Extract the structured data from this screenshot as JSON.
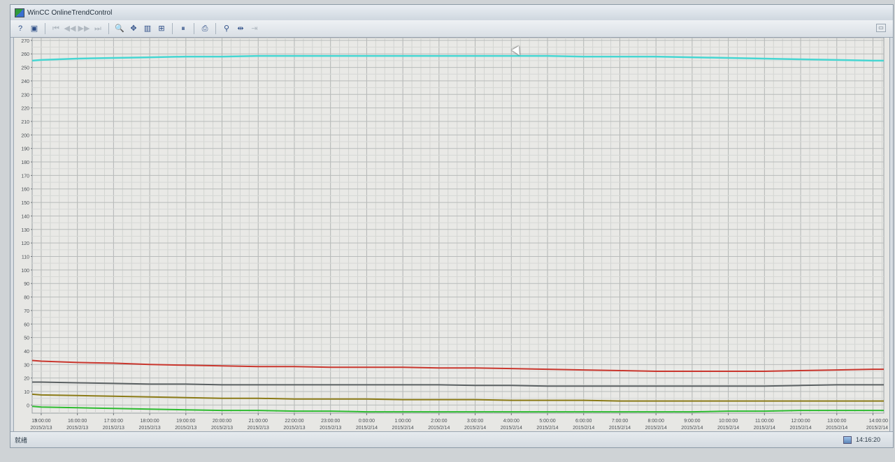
{
  "window": {
    "title": "WinCC OnlineTrendControl"
  },
  "toolbar": {
    "buttons": [
      {
        "name": "help-icon",
        "glyph": "?",
        "enabled": true
      },
      {
        "name": "config-dialog-icon",
        "glyph": "▣",
        "enabled": true
      },
      {
        "name": "first-record-icon",
        "glyph": "⏮",
        "enabled": false
      },
      {
        "name": "previous-record-icon",
        "glyph": "◀◀",
        "enabled": false
      },
      {
        "name": "next-record-icon",
        "glyph": "▶▶",
        "enabled": false
      },
      {
        "name": "last-record-icon",
        "glyph": "⏭",
        "enabled": false
      },
      {
        "name": "zoom-area-icon",
        "glyph": "🔍",
        "enabled": true
      },
      {
        "name": "move-axes-icon",
        "glyph": "✥",
        "enabled": true
      },
      {
        "name": "select-trend-icon",
        "glyph": "▥",
        "enabled": true
      },
      {
        "name": "original-view-icon",
        "glyph": "⊞",
        "enabled": true
      },
      {
        "name": "stop-icon",
        "glyph": "⏸",
        "enabled": true
      },
      {
        "name": "print-icon",
        "glyph": "⎙",
        "enabled": true
      },
      {
        "name": "ruler-icon",
        "glyph": "⚲",
        "enabled": true
      },
      {
        "name": "select-time-range-icon",
        "glyph": "⇹",
        "enabled": true
      },
      {
        "name": "export-icon",
        "glyph": "⇥",
        "enabled": false
      }
    ]
  },
  "chart_data": {
    "type": "line",
    "yticks": [
      0,
      10,
      20,
      30,
      40,
      50,
      60,
      70,
      80,
      90,
      100,
      110,
      120,
      130,
      140,
      150,
      160,
      170,
      180,
      190,
      200,
      210,
      220,
      230,
      240,
      250,
      260,
      270
    ],
    "ytick_labels": [
      "0",
      "10",
      "20",
      "30",
      "40",
      "50",
      "60",
      "70",
      "80",
      "90",
      "100",
      "110",
      "120",
      "130",
      "140",
      "150",
      "160",
      "170",
      "180",
      "190",
      "200",
      "210",
      "220",
      "230",
      "240",
      "250",
      "260",
      "270"
    ],
    "ylim": [
      -6,
      272
    ],
    "x_ticks": [
      {
        "time": "15:00:00",
        "date": "2015/2/13"
      },
      {
        "time": "16:00:00",
        "date": "2015/2/13"
      },
      {
        "time": "17:00:00",
        "date": "2015/2/13"
      },
      {
        "time": "18:00:00",
        "date": "2015/2/13"
      },
      {
        "time": "19:00:00",
        "date": "2015/2/13"
      },
      {
        "time": "20:00:00",
        "date": "2015/2/13"
      },
      {
        "time": "21:00:00",
        "date": "2015/2/13"
      },
      {
        "time": "22:00:00",
        "date": "2015/2/13"
      },
      {
        "time": "23:00:00",
        "date": "2015/2/13"
      },
      {
        "time": "0:00:00",
        "date": "2015/2/14"
      },
      {
        "time": "1:00:00",
        "date": "2015/2/14"
      },
      {
        "time": "2:00:00",
        "date": "2015/2/14"
      },
      {
        "time": "3:00:00",
        "date": "2015/2/14"
      },
      {
        "time": "4:00:00",
        "date": "2015/2/14"
      },
      {
        "time": "5:00:00",
        "date": "2015/2/14"
      },
      {
        "time": "6:00:00",
        "date": "2015/2/14"
      },
      {
        "time": "7:00:00",
        "date": "2015/2/14"
      },
      {
        "time": "8:00:00",
        "date": "2015/2/14"
      },
      {
        "time": "9:00:00",
        "date": "2015/2/14"
      },
      {
        "time": "10:00:00",
        "date": "2015/2/14"
      },
      {
        "time": "11:00:00",
        "date": "2015/2/14"
      },
      {
        "time": "12:00:00",
        "date": "2015/2/14"
      },
      {
        "time": "13:00:00",
        "date": "2015/2/14"
      },
      {
        "time": "14:00:00",
        "date": "2015/2/14"
      }
    ],
    "x_start_label": "3",
    "x_hours": [
      14.75,
      15,
      16,
      17,
      18,
      19,
      20,
      21,
      22,
      23,
      24,
      25,
      26,
      27,
      28,
      29,
      30,
      31,
      32,
      33,
      34,
      35,
      36,
      37,
      38,
      38.3
    ],
    "series": [
      {
        "color": "#46d6d2",
        "values": [
          255,
          255.5,
          256.5,
          257,
          257.5,
          258,
          258,
          258.5,
          258.5,
          258.5,
          258.5,
          258.5,
          258.5,
          258.5,
          258.5,
          258.5,
          258,
          258,
          258,
          257.5,
          257,
          256.5,
          256,
          255.5,
          255,
          255
        ]
      },
      {
        "color": "#c9362d",
        "values": [
          33,
          32.5,
          31.5,
          31,
          30,
          29.5,
          29,
          28.5,
          28.5,
          28,
          28,
          28,
          27.5,
          27.5,
          27,
          26.5,
          26,
          25.5,
          25,
          25,
          25,
          25,
          25.5,
          26,
          26.5,
          26.5
        ]
      },
      {
        "color": "#5a6062",
        "values": [
          17,
          17,
          16.5,
          16,
          15.5,
          15.5,
          15,
          15,
          15,
          15,
          15,
          15,
          15,
          14.5,
          14.5,
          14,
          14,
          14,
          14,
          14,
          14,
          14,
          14.5,
          15,
          15,
          15
        ]
      },
      {
        "color": "#8a7a16",
        "values": [
          8,
          7.5,
          7,
          6.5,
          6,
          5.5,
          5,
          5,
          4.5,
          4.5,
          4.5,
          4,
          4,
          4,
          3.5,
          3.5,
          3.5,
          3,
          3,
          3,
          3,
          3,
          3,
          3,
          3,
          3
        ]
      },
      {
        "color": "#2dbb2f",
        "values": [
          -1,
          -1.5,
          -2,
          -2.5,
          -3,
          -3.5,
          -4,
          -4,
          -4.5,
          -4.5,
          -5,
          -5,
          -5,
          -5,
          -5,
          -5,
          -5,
          -5,
          -5,
          -5,
          -4.5,
          -4.5,
          -4,
          -4,
          -4,
          -4
        ]
      }
    ],
    "grid": true,
    "legend": "none"
  },
  "status": {
    "left_text": "就绪",
    "time": "14:16:20"
  }
}
